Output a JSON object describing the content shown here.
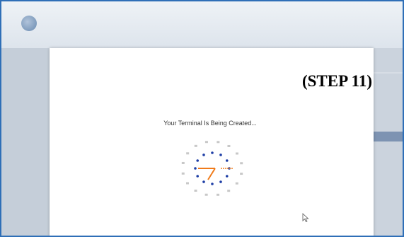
{
  "modal": {
    "step_label": "(STEP 11)",
    "status_text": "Your Terminal Is Being Created..."
  },
  "spinner": {
    "icon": "loading-clock-spinner-icon",
    "colors": {
      "active_dot": "#1f3fa6",
      "inactive_dot": "#c8c8c8",
      "hand": "#f07b1a"
    }
  },
  "colors": {
    "frame_border": "#2f6fb7",
    "backdrop": "#c9d2dc",
    "modal_bg": "#ffffff"
  }
}
